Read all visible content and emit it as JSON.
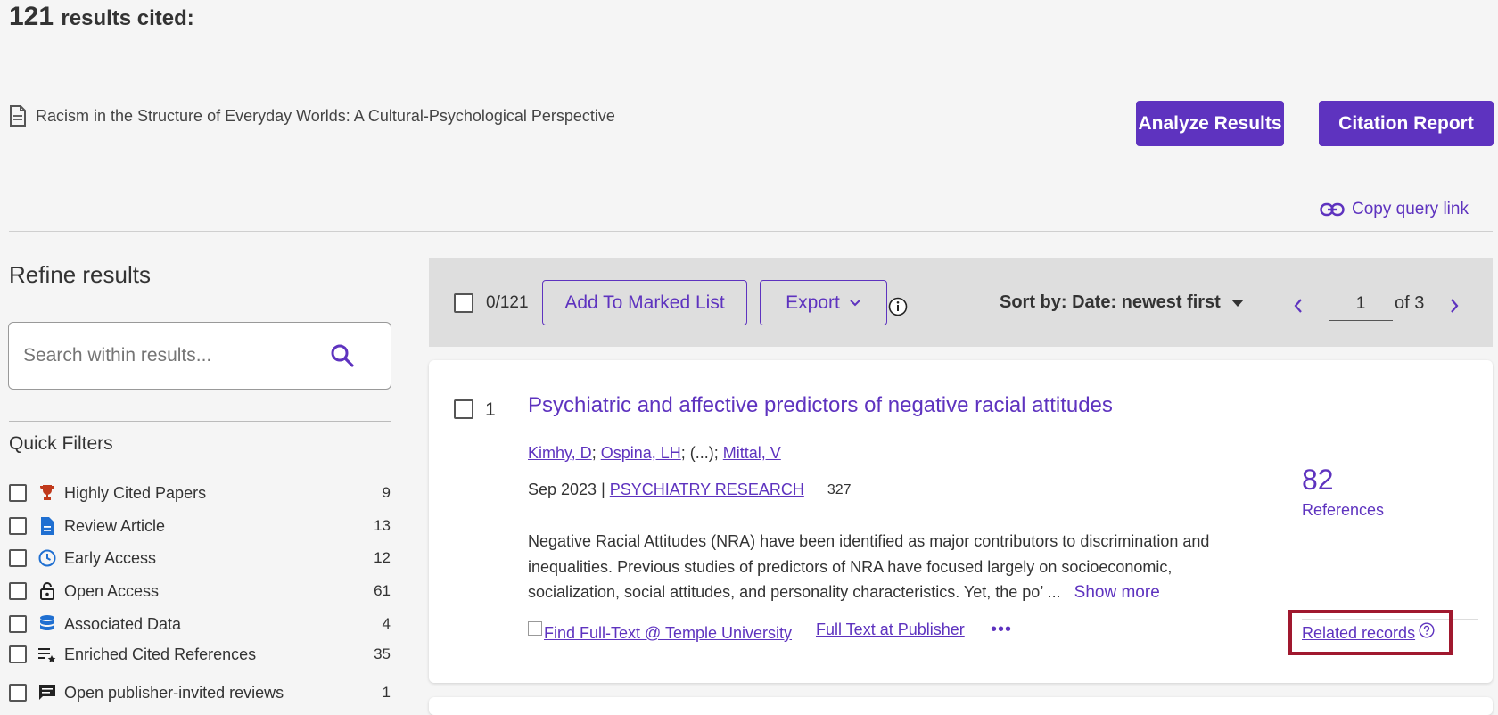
{
  "header": {
    "count": "121",
    "count_suffix": "results cited:",
    "cited_doc_title": "Racism in the Structure of Everyday Worlds: A Cultural-Psychological Perspective",
    "analyze_label": "Analyze Results",
    "citation_report_label": "Citation Report",
    "copy_query_label": "Copy query link"
  },
  "sidebar": {
    "refine_title": "Refine results",
    "search_placeholder": "Search within results...",
    "quick_filters_title": "Quick Filters",
    "filters": [
      {
        "label": "Highly Cited Papers",
        "count": "9",
        "icon": "trophy-icon"
      },
      {
        "label": "Review Article",
        "count": "13",
        "icon": "document-icon"
      },
      {
        "label": "Early Access",
        "count": "12",
        "icon": "clock-icon"
      },
      {
        "label": "Open Access",
        "count": "61",
        "icon": "unlock-icon"
      },
      {
        "label": "Associated Data",
        "count": "4",
        "icon": "database-icon"
      },
      {
        "label": "Enriched Cited References",
        "count": "35",
        "icon": "enriched-list-icon"
      },
      {
        "label": "Open publisher-invited reviews",
        "count": "1",
        "icon": "comment-icon"
      }
    ]
  },
  "toolbar": {
    "selected_count": "0/121",
    "add_to_marked_label": "Add To Marked List",
    "export_label": "Export",
    "sort_label": "Sort by: Date: newest first",
    "page_value": "1",
    "page_total": "of 3"
  },
  "record": {
    "index": "1",
    "title": "Psychiatric and affective predictors of negative racial attitudes",
    "author1": "Kimhy, D",
    "author2": "Ospina, LH",
    "author_ellipsis": "(...)",
    "author3": "Mittal, V",
    "date": "Sep 2023",
    "journal": "PSYCHIATRY RESEARCH",
    "volume": "327",
    "abstract_line1": "Negative Racial Attitudes (NRA) have been identified as major contributors to discrimination and",
    "abstract_line2": "inequalities. Previous studies of predictors of NRA have focused largely on socioeconomic,",
    "abstract_line3": "socialization, social attitudes, and personality characteristics. Yet, the po’ ...",
    "show_more": "Show more",
    "find_fulltext_alt": "Find Full-Text @ Temple University",
    "full_text_publisher": "Full Text at Publisher",
    "more_dots": "•••",
    "references_count": "82",
    "references_label": "References",
    "related_records": "Related records"
  },
  "colors": {
    "accent": "#5e33bf",
    "highlight_border": "#a0182e",
    "toolbar_bg": "#dedede"
  }
}
